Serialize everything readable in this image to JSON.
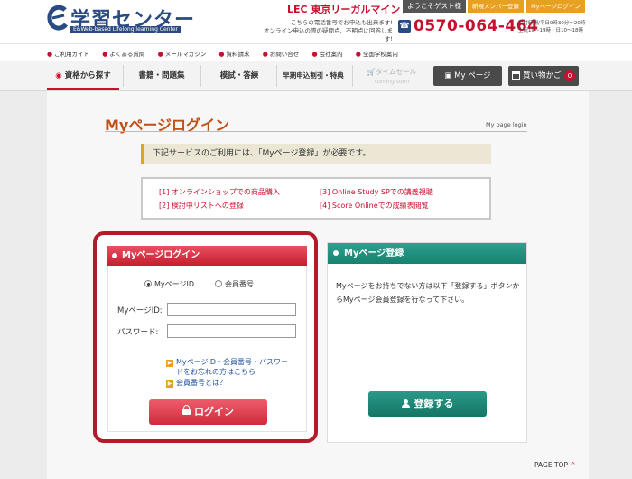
{
  "header": {
    "logo_title": "学習センター",
    "logo_sub": "E&Web-based Lifelong learning Center",
    "lec_brand": "LEC 東京リーガルマインド",
    "tel_note_line1": "こちらの電話番号でお申込も出来ます!",
    "tel_note_line2": "オンライン申込の際の疑問点、不明点に回答します!",
    "tel_number": "0570-064-464",
    "tel_hours_line1": "受付時間/平日9時30分～20時",
    "tel_hours_line2": "土祝10～19時・日10～18時",
    "welcome": "ようこそゲスト様",
    "new_member_label": "新規メンバー登録",
    "mypage_login_label": "Myページログイン"
  },
  "utility_nav": [
    "ご利用ガイド",
    "よくある質問",
    "メールマガジン",
    "資料請求",
    "お問い合せ",
    "会社案内",
    "全国学校案内"
  ],
  "main_nav": {
    "license": "資格から探す",
    "books": "書籍・問題集",
    "mock": "模試・答練",
    "early": "早期申込割引・特典",
    "timesale": "タイムセール",
    "timesale_sub": "coming soon",
    "mypage": "My ページ",
    "cart": "買い物かご",
    "cart_count": "0"
  },
  "page": {
    "title": "Myページログイン",
    "breadcrumb": "My page login",
    "notice": "下記サービスのご利用には、「Myページ登録」が必要です。",
    "services": [
      "[1] オンラインショップでの商品購入",
      "[2] 検討中リストへの登録",
      "[3] Online Study SPでの講義視聴",
      "[4] Score Onlineでの成績表閲覧"
    ]
  },
  "login": {
    "heading": "Myページログイン",
    "radio_id": "MyページID",
    "radio_member": "会員番号",
    "label_id": "MyページID:",
    "label_pw": "パスワード:",
    "id_value": "",
    "pw_value": "",
    "forgot_line1": "MyページID・会員番号・パスワー",
    "forgot_line2": "ドをお忘れの方はこちら",
    "what_is_member": "会員番号とは？",
    "button": "ログイン"
  },
  "register": {
    "heading": "Myページ登録",
    "text": "Myページをお持ちでない方は以下「登録する」ボタンからMyページ会員登録を行なって下さい。",
    "button": "登録する"
  },
  "footer": {
    "pagetop": "PAGE TOP"
  },
  "colors": {
    "brand_blue": "#2a4a82",
    "accent_red": "#c8102e",
    "title_orange": "#c05018",
    "teal": "#17816f",
    "orange": "#e8a020"
  }
}
